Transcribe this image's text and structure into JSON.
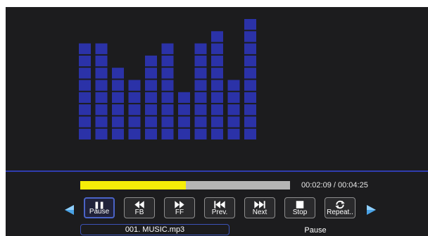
{
  "player": {
    "colors": {
      "background": "#1c1c1e",
      "visualizer_bar": "#2b32a8",
      "divider": "#2f3cae",
      "progress_fill": "#f6ee08",
      "progress_track": "#b5b5b5",
      "selected_border": "#4a63c7",
      "nav_arrow": "#4aa3e6"
    },
    "visualizer": {
      "levels": [
        8,
        8,
        6,
        5,
        7,
        8,
        4,
        8,
        9,
        5,
        10
      ]
    },
    "progress": {
      "fraction": 0.505,
      "time_text": "00:02:09 / 00:04:25"
    },
    "controls": [
      {
        "label": "Pause",
        "icon": "pause-icon",
        "selected": true
      },
      {
        "label": "FB",
        "icon": "fast-backward-icon",
        "selected": false
      },
      {
        "label": "FF",
        "icon": "fast-forward-icon",
        "selected": false
      },
      {
        "label": "Prev.",
        "icon": "previous-track-icon",
        "selected": false
      },
      {
        "label": "Next",
        "icon": "next-track-icon",
        "selected": false
      },
      {
        "label": "Stop",
        "icon": "stop-icon",
        "selected": false
      },
      {
        "label": "Repeat..",
        "icon": "repeat-icon",
        "selected": false
      }
    ],
    "nav_arrows": {
      "left_icon": "arrow-left-icon",
      "right_icon": "arrow-right-icon"
    },
    "file_name": "001. MUSIC.mp3",
    "status": "Pause"
  }
}
